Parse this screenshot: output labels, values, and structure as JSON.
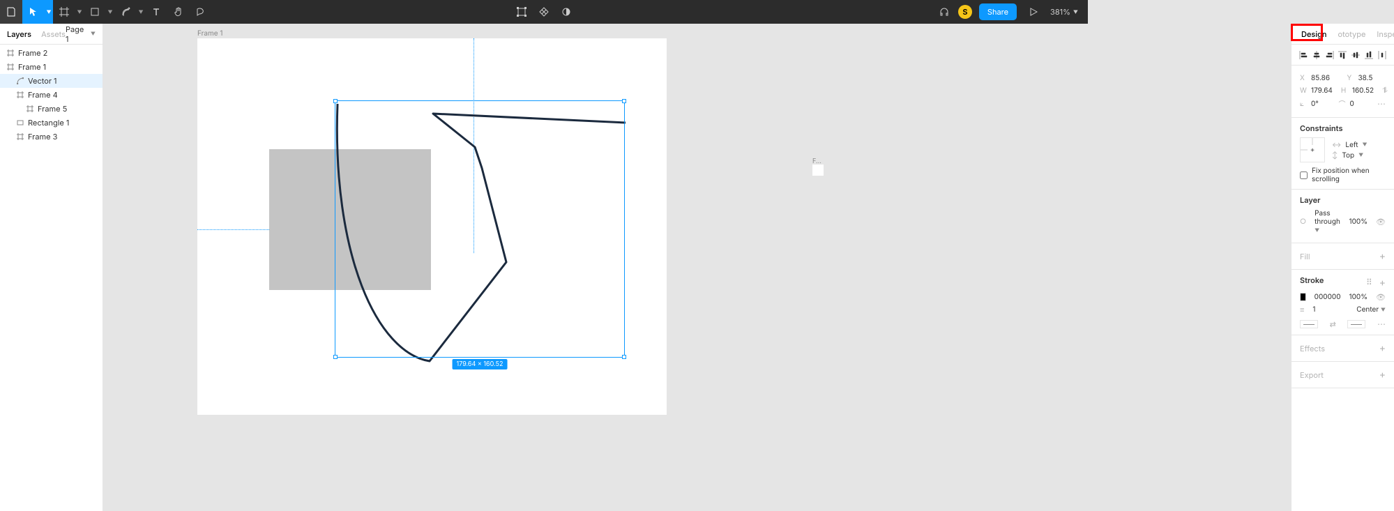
{
  "toolbar": {
    "share_label": "Share",
    "zoom": "381%",
    "avatar": "S"
  },
  "left_panel": {
    "tabs": {
      "layers": "Layers",
      "assets": "Assets"
    },
    "page": "Page 1",
    "layers": [
      {
        "name": "Frame 2",
        "depth": 0,
        "icon": "frame",
        "selected": false
      },
      {
        "name": "Frame 1",
        "depth": 0,
        "icon": "frame",
        "selected": false
      },
      {
        "name": "Vector 1",
        "depth": 1,
        "icon": "vector",
        "selected": true
      },
      {
        "name": "Frame 4",
        "depth": 1,
        "icon": "frame",
        "selected": false
      },
      {
        "name": "Frame 5",
        "depth": 2,
        "icon": "frame",
        "selected": false
      },
      {
        "name": "Rectangle 1",
        "depth": 1,
        "icon": "rect",
        "selected": false
      },
      {
        "name": "Frame 3",
        "depth": 1,
        "icon": "frame",
        "selected": false
      }
    ]
  },
  "canvas": {
    "frame_label": "Frame 1",
    "small_frame_label": "F...",
    "dimensions_badge": "179.64 × 160.52"
  },
  "right_panel": {
    "tabs": {
      "design": "Design",
      "prototype": "ototype",
      "inspect": "Inspect"
    },
    "position": {
      "x_label": "X",
      "x": "85.86",
      "y_label": "Y",
      "y": "38.5",
      "w_label": "W",
      "w": "179.64",
      "h_label": "H",
      "h": "160.52",
      "r_label": "⟀",
      "r": "0°",
      "c_label": "⌒",
      "c": "0"
    },
    "constraints": {
      "title": "Constraints",
      "h": "Left",
      "v": "Top",
      "fix_label": "Fix position when scrolling"
    },
    "layer": {
      "title": "Layer",
      "blend": "Pass through",
      "opacity": "100%"
    },
    "fill": {
      "title": "Fill"
    },
    "stroke": {
      "title": "Stroke",
      "color": "000000",
      "opacity": "100%",
      "weight": "1",
      "align": "Center"
    },
    "effects": {
      "title": "Effects"
    },
    "export": {
      "title": "Export"
    }
  }
}
